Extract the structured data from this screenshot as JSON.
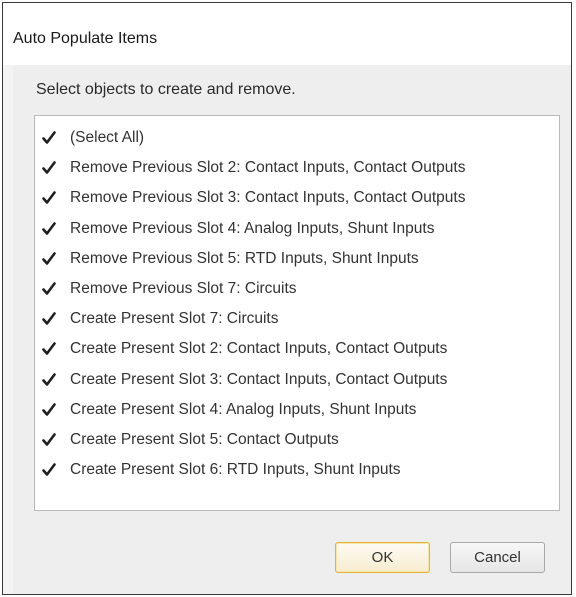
{
  "dialog": {
    "title": "Auto Populate Items",
    "instruction": "Select objects to create and remove."
  },
  "items": [
    {
      "label": "(Select All)",
      "checked": true
    },
    {
      "label": "Remove Previous Slot 2: Contact Inputs, Contact Outputs",
      "checked": true
    },
    {
      "label": "Remove Previous Slot 3: Contact Inputs, Contact Outputs",
      "checked": true
    },
    {
      "label": "Remove Previous Slot 4: Analog Inputs, Shunt Inputs",
      "checked": true
    },
    {
      "label": "Remove Previous Slot 5: RTD Inputs, Shunt Inputs",
      "checked": true
    },
    {
      "label": "Remove Previous Slot 7: Circuits",
      "checked": true
    },
    {
      "label": "Create Present Slot 7: Circuits",
      "checked": true
    },
    {
      "label": "Create Present Slot 2: Contact Inputs, Contact Outputs",
      "checked": true
    },
    {
      "label": "Create Present Slot 3: Contact Inputs, Contact Outputs",
      "checked": true
    },
    {
      "label": "Create Present Slot 4: Analog Inputs, Shunt Inputs",
      "checked": true
    },
    {
      "label": "Create Present Slot 5: Contact Outputs",
      "checked": true
    },
    {
      "label": "Create Present Slot 6: RTD Inputs, Shunt Inputs",
      "checked": true
    }
  ],
  "buttons": {
    "ok_label": "OK",
    "cancel_label": "Cancel"
  },
  "icons": {
    "check": "checkmark-icon"
  }
}
